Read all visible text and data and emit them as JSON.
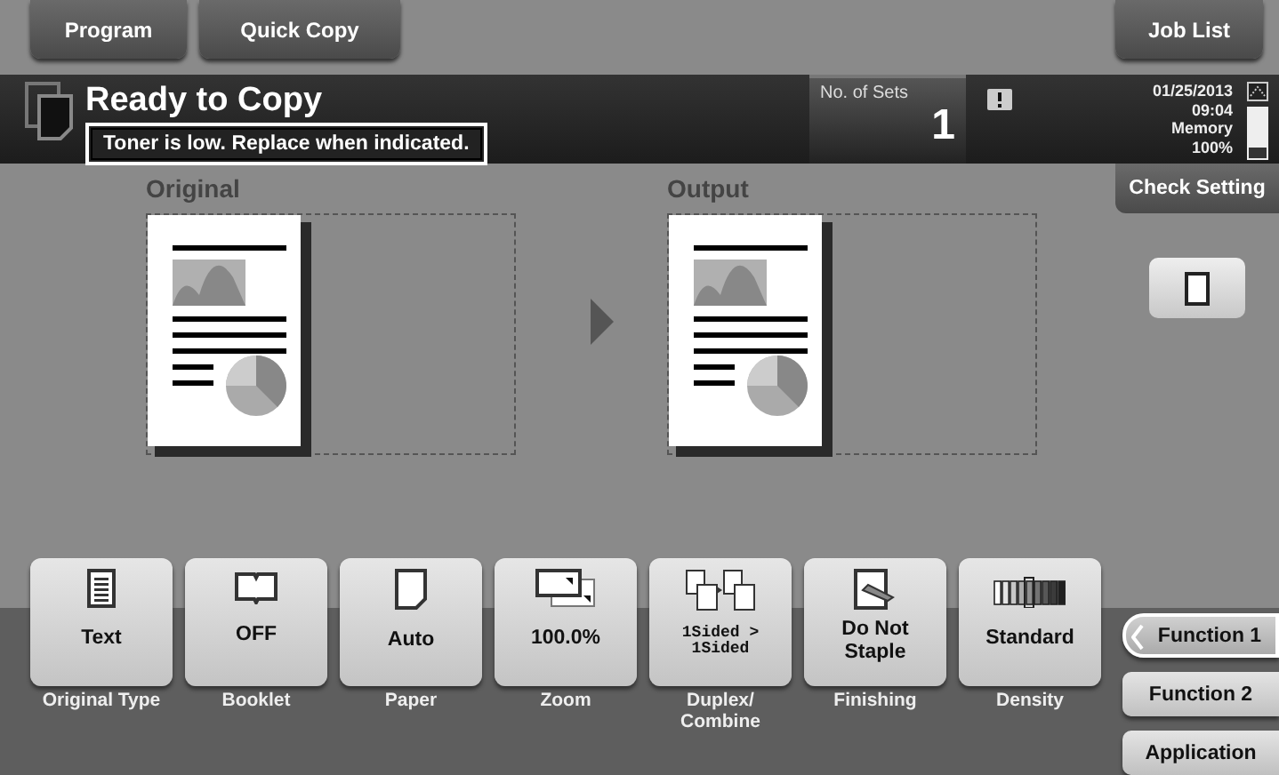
{
  "top_buttons": [
    {
      "label": "Program"
    },
    {
      "label": "Quick Copy"
    }
  ],
  "job_list": {
    "label": "Job List"
  },
  "header": {
    "title": "Ready to Copy",
    "message": "Toner is low. Replace when indicated.",
    "sets_label": "No. of Sets",
    "sets_value": "1",
    "date": "01/25/2013",
    "time": "09:04",
    "memory_label": "Memory",
    "memory_value": "100%"
  },
  "check_setting": {
    "label": "Check Setting"
  },
  "preview": {
    "original_label": "Original",
    "output_label": "Output"
  },
  "settings": [
    {
      "kind": "text-doc",
      "value": "Text",
      "label": "Original Type"
    },
    {
      "kind": "book",
      "value": "OFF",
      "label": "Booklet"
    },
    {
      "kind": "page",
      "value": "Auto",
      "label": "Paper"
    },
    {
      "kind": "zoom",
      "value": "100.0%",
      "label": "Zoom"
    },
    {
      "kind": "duplex",
      "value": "1Sided >\n1Sided",
      "label": "Duplex/\nCombine"
    },
    {
      "kind": "staple",
      "value": "Do Not\nStaple",
      "label": "Finishing"
    },
    {
      "kind": "density",
      "value": "Standard",
      "label": "Density"
    }
  ],
  "function_tabs": [
    {
      "label": "Function 1",
      "selected": true
    },
    {
      "label": "Function 2",
      "selected": false
    },
    {
      "label": "Application",
      "selected": false
    }
  ]
}
